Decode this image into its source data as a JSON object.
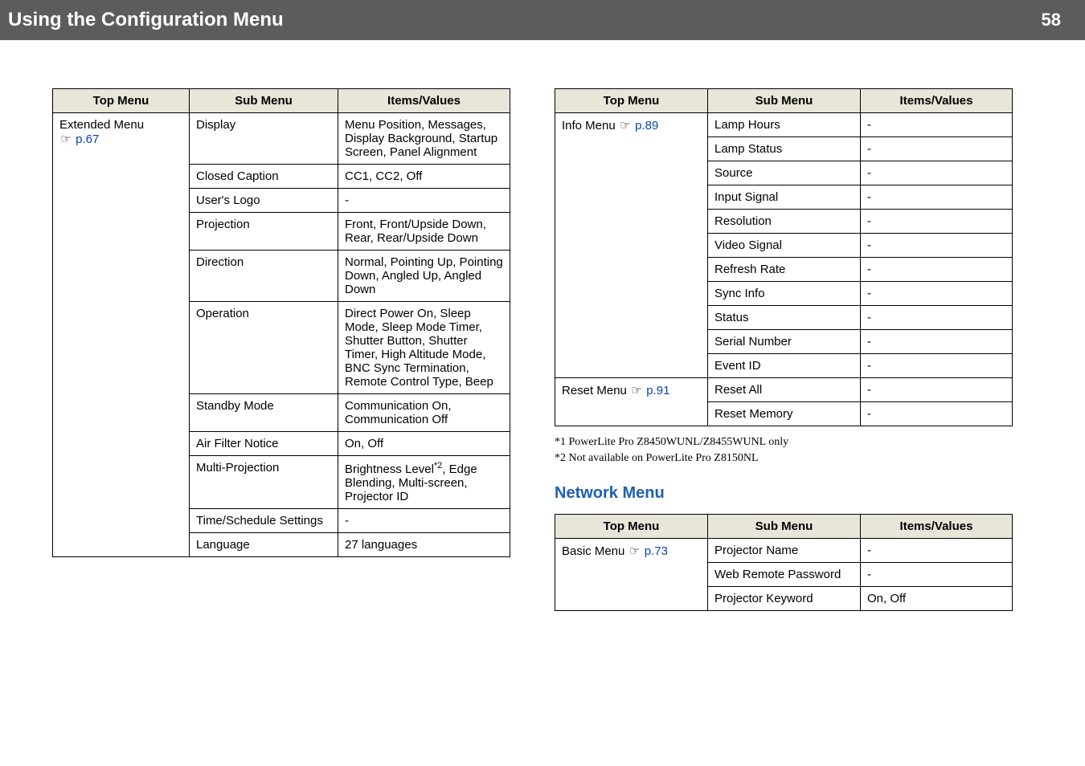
{
  "header": {
    "title": "Using the Configuration Menu",
    "page": "58"
  },
  "tableLeft": {
    "headers": [
      "Top Menu",
      "Sub Menu",
      "Items/Values"
    ],
    "topMenu": {
      "label": "Extended Menu",
      "ref": "p.67"
    },
    "rows": [
      {
        "sub": "Display",
        "val": "Menu Position, Messages, Display Background, Startup Screen, Panel Alignment"
      },
      {
        "sub": "Closed Caption",
        "val": "CC1, CC2, Off"
      },
      {
        "sub": "User's Logo",
        "val": "-"
      },
      {
        "sub": "Projection",
        "val": "Front, Front/Upside Down, Rear, Rear/Upside Down"
      },
      {
        "sub": "Direction",
        "val": "Normal, Pointing Up, Pointing Down, Angled Up, Angled Down"
      },
      {
        "sub": "Operation",
        "val": "Direct Power On, Sleep Mode, Sleep Mode Timer, Shutter Button, Shutter Timer, High Altitude Mode, BNC Sync Termination, Remote Control Type, Beep"
      },
      {
        "sub": "Standby Mode",
        "val": "Communication On, Communication Off"
      },
      {
        "sub": "Air Filter Notice",
        "val": "On, Off"
      },
      {
        "sub": "Multi-Projection",
        "val_prefix": "Brightness Level",
        "val_sup": "*2",
        "val_suffix": ", Edge Blending, Multi-screen, Projector ID"
      },
      {
        "sub": "Time/Schedule Settings",
        "val": "-"
      },
      {
        "sub": "Language",
        "val": "27 languages"
      }
    ]
  },
  "tableRight1": {
    "headers": [
      "Top Menu",
      "Sub Menu",
      "Items/Values"
    ],
    "groups": [
      {
        "topMenu": {
          "label": "Info Menu",
          "ref": "p.89"
        },
        "rows": [
          {
            "sub": "Lamp Hours",
            "val": "-"
          },
          {
            "sub": "Lamp Status",
            "val": "-"
          },
          {
            "sub": "Source",
            "val": "-"
          },
          {
            "sub": "Input Signal",
            "val": "-"
          },
          {
            "sub": "Resolution",
            "val": "-"
          },
          {
            "sub": "Video Signal",
            "val": "-"
          },
          {
            "sub": "Refresh Rate",
            "val": "-"
          },
          {
            "sub": "Sync Info",
            "val": "-"
          },
          {
            "sub": "Status",
            "val": "-"
          },
          {
            "sub": "Serial Number",
            "val": "-"
          },
          {
            "sub": "Event ID",
            "val": "-"
          }
        ]
      },
      {
        "topMenu": {
          "label": "Reset Menu",
          "ref": "p.91"
        },
        "rows": [
          {
            "sub": "Reset All",
            "val": "-"
          },
          {
            "sub": "Reset Memory",
            "val": "-"
          }
        ]
      }
    ]
  },
  "footnotes": {
    "f1": "*1  PowerLite Pro Z8450WUNL/Z8455WUNL only",
    "f2": "*2  Not available on PowerLite Pro Z8150NL"
  },
  "section2Heading": "Network Menu",
  "tableRight2": {
    "headers": [
      "Top Menu",
      "Sub Menu",
      "Items/Values"
    ],
    "topMenu": {
      "label": "Basic Menu",
      "ref": "p.73"
    },
    "rows": [
      {
        "sub": "Projector Name",
        "val": "-"
      },
      {
        "sub": "Web Remote Password",
        "val": "-"
      },
      {
        "sub": "Projector Keyword",
        "val": "On, Off"
      }
    ]
  }
}
